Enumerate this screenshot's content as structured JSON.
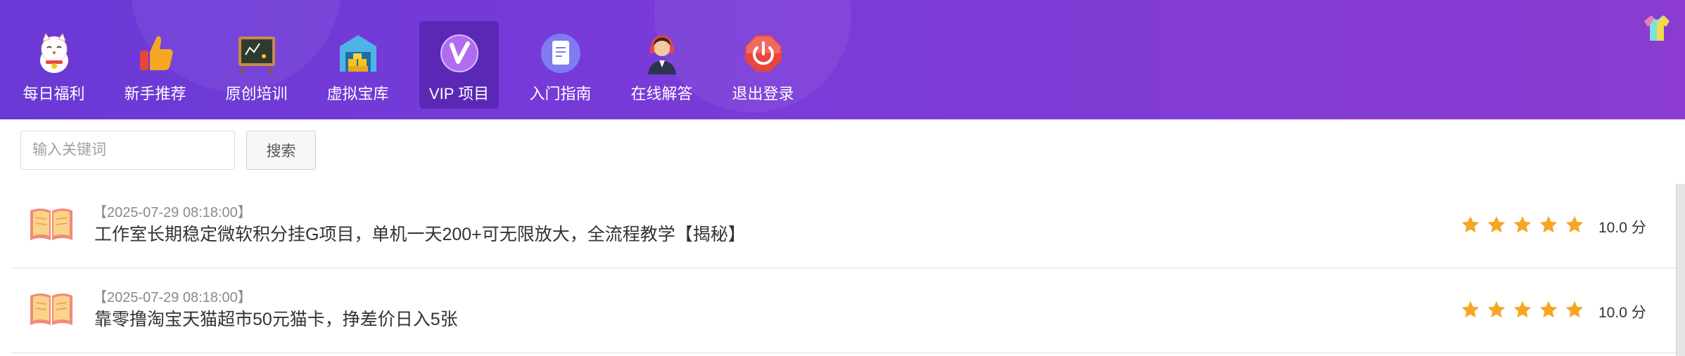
{
  "nav": {
    "items": [
      {
        "label": "每日福利",
        "icon": "lucky-cat-icon",
        "active": false
      },
      {
        "label": "新手推荐",
        "icon": "thumbs-up-icon",
        "active": false
      },
      {
        "label": "原创培训",
        "icon": "chalkboard-icon",
        "active": false
      },
      {
        "label": "虚拟宝库",
        "icon": "treasure-warehouse-icon",
        "active": false
      },
      {
        "label": "VIP 项目",
        "icon": "vip-badge-icon",
        "active": true
      },
      {
        "label": "入门指南",
        "icon": "document-icon",
        "active": false
      },
      {
        "label": "在线解答",
        "icon": "support-agent-icon",
        "active": false
      },
      {
        "label": "退出登录",
        "icon": "power-icon",
        "active": false
      }
    ]
  },
  "search": {
    "placeholder": "输入关键词",
    "value": "",
    "button_label": "搜索"
  },
  "articles": [
    {
      "date": "【2025-07-29 08:18:00】",
      "title": "工作室长期稳定微软积分挂G项目，单机一天200+可无限放大，全流程教学【揭秘】",
      "rating": 5,
      "score": "10.0 分"
    },
    {
      "date": "【2025-07-29 08:18:00】",
      "title": "靠零撸淘宝天猫超市50元猫卡，挣差价日入5张",
      "rating": 5,
      "score": "10.0 分"
    }
  ],
  "colors": {
    "header_start": "#6a39d6",
    "header_end": "#8b3bd0",
    "star": "#f5a623",
    "book": "#f28a7a"
  }
}
